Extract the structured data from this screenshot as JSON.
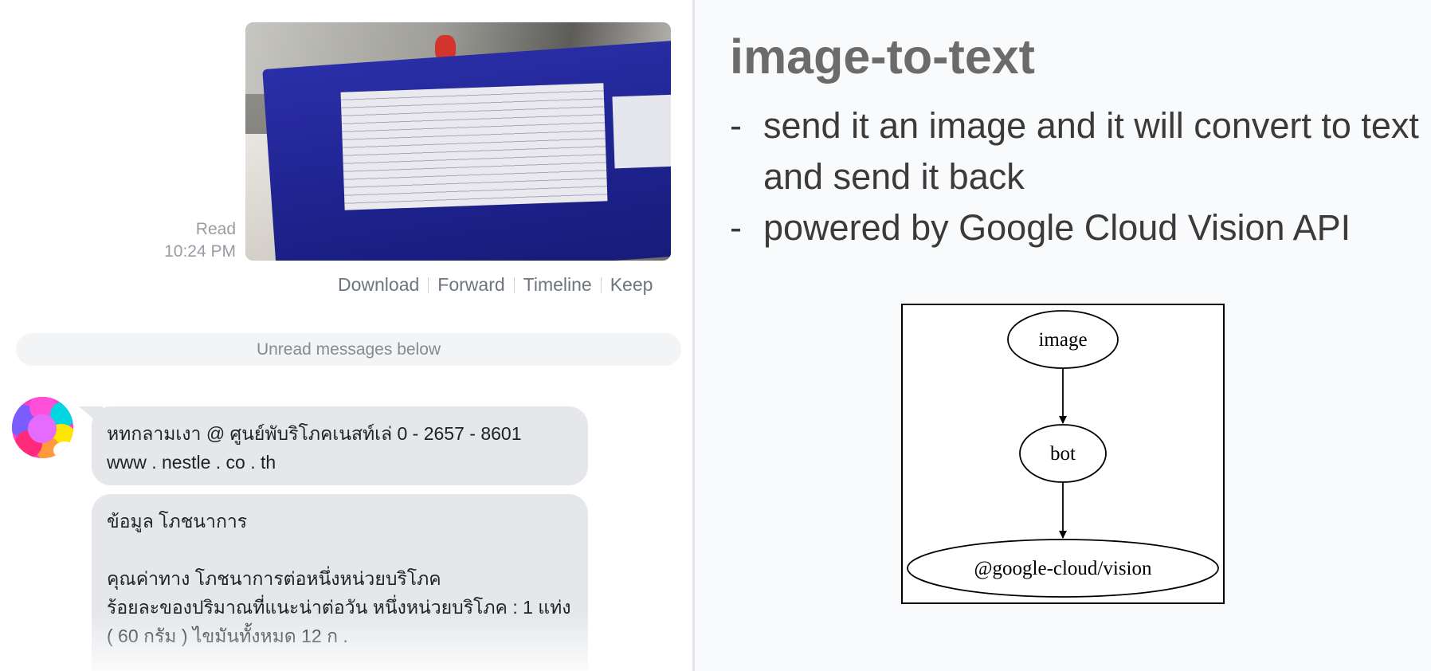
{
  "chat": {
    "read_status": "Read",
    "read_time": "10:24 PM",
    "actions": [
      "Download",
      "Forward",
      "Timeline",
      "Keep"
    ],
    "unread_divider": "Unread messages below",
    "messages": [
      {
        "text": "หทกลามเงา @ ศูนย์พับริโภคเนสท์เล่ 0 - 2657 - 8601\nwww . nestle . co . th"
      },
      {
        "text": "ข้อมูล โภชนาการ\n\nคุณค่าทาง โภชนาการต่อหนึ่งหน่วยบริโภค\nร้อยละของปริมาณที่แนะน่าต่อวัน หนึ่งหน่วยบริโภค : 1 แท่ง\n( 60 กรัม ) ไขมันทั้งหมด 12 ก ."
      }
    ]
  },
  "slide": {
    "title": "image-to-text",
    "bullets": [
      "send it an image and it will convert to text and send it back",
      "powered by Google Cloud Vision API"
    ],
    "bullet_marker": "-",
    "diagram": {
      "nodes": [
        "image",
        "bot",
        "@google-cloud/vision"
      ]
    }
  },
  "colors": {
    "bubble_background": "#e5e7ea",
    "title_text": "#6b6b6b",
    "body_text": "#3a3a3a",
    "package_blue": "#1e238f"
  }
}
